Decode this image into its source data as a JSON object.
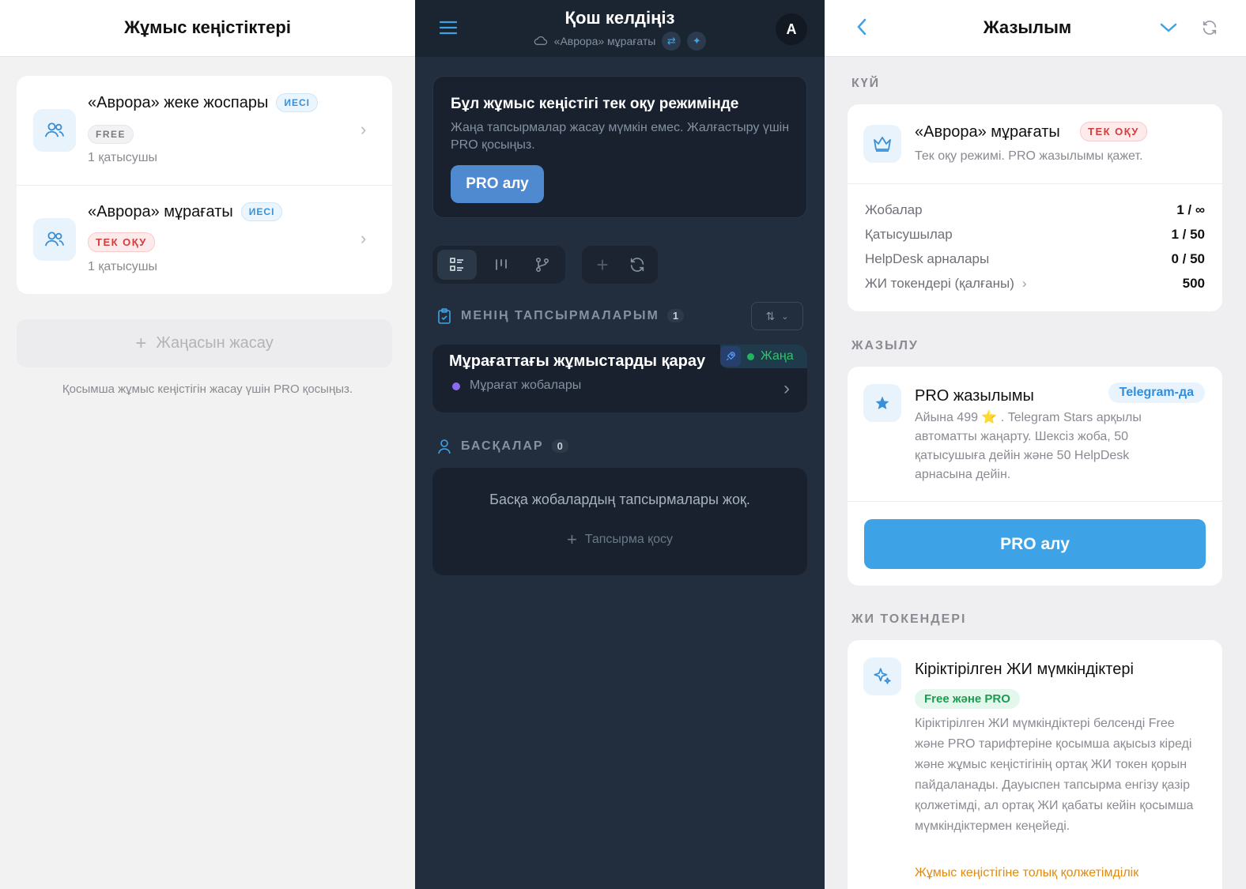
{
  "workspaces": {
    "title": "Жұмыс кеңістіктері",
    "items": [
      {
        "name": "«Аврора» жеке жоспары",
        "role": "ИЕСІ",
        "plan": "FREE",
        "members": "1 қатысушы"
      },
      {
        "name": "«Аврора» мұрағаты",
        "role": "ИЕСІ",
        "plan": "ТЕК ОҚУ",
        "members": "1 қатысушы"
      }
    ],
    "create_label": "Жаңасын жасау",
    "hint": "Қосымша жұмыс кеңістігін жасау үшін PRO қосыңыз."
  },
  "main": {
    "title": "Қош келдіңіз",
    "workspace": "«Аврора» мұрағаты",
    "avatar": "A",
    "readonly_title": "Бұл жұмыс кеңістігі тек оқу режимінде",
    "readonly_text": "Жаңа тапсырмалар жасау мүмкін емес. Жалғастыру үшін PRO қосыңыз.",
    "pro_button": "PRO алу",
    "my_tasks_label": "МЕНІҢ ТАПСЫРМАЛАРЫМ",
    "my_tasks_count": "1",
    "task": {
      "title": "Мұрағаттағы жұмыстарды қарау",
      "project": "Мұрағат жобалары",
      "status": "Жаңа"
    },
    "others_label": "БАСҚАЛАР",
    "others_count": "0",
    "empty_text": "Басқа жобалардың тапсырмалары жоқ.",
    "add_task": "Тапсырма қосу"
  },
  "subscription": {
    "title": "Жазылым",
    "state_label": "КҮЙ",
    "ws_name": "«Аврора» мұрағаты",
    "ws_badge": "ТЕК ОҚУ",
    "ws_desc": "Тек оқу режимі. PRO жазылымы қажет.",
    "stats": [
      {
        "k": "Жобалар",
        "v": "1 / ∞"
      },
      {
        "k": "Қатысушылар",
        "v": "1 / 50"
      },
      {
        "k": "HelpDesk арналары",
        "v": "0 / 50"
      },
      {
        "k": "ЖИ токендері (қалғаны)",
        "v": "500"
      }
    ],
    "sub_label": "ЖАЗЫЛУ",
    "pro_name": "PRO жазылымы",
    "pro_badge": "Telegram-да",
    "pro_desc": "Айына 499 ⭐ . Telegram Stars арқылы автоматты жаңарту. Шексіз жоба, 50 қатысушыға дейін және 50 HelpDesk арнасына дейін.",
    "pro_button": "PRO алу",
    "ai_label": "ЖИ ТОКЕНДЕРІ",
    "ai_title": "Кіріктірілген ЖИ мүмкіндіктері",
    "ai_badge": "Free және PRO",
    "ai_desc": "Кіріктірілген ЖИ мүмкіндіктері белсенді Free және PRO тарифтеріне қосымша ақысыз кіреді және жұмыс кеңістігінің ортақ ЖИ токен қорын пайдаланады. Дауыспен тапсырма енгізу қазір қолжетімді, ал ортақ ЖИ қабаты кейін қосымша мүмкіндіктермен кеңейеді.",
    "ai_warning": "Жұмыс кеңістігіне толық қолжетімділік"
  },
  "colors": {
    "accent": "#3ea3e6",
    "dark_bg": "#222e3d",
    "danger": "#d63b3b",
    "success": "#22b35e",
    "warning": "#e08a10"
  }
}
